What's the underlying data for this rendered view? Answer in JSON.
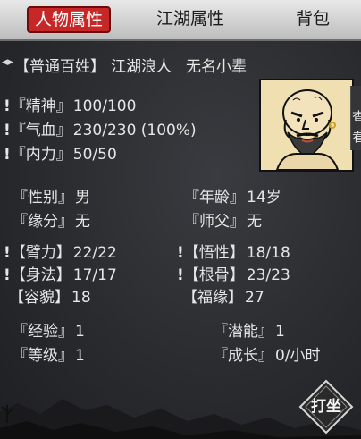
{
  "tabs": [
    {
      "label": "人物属性",
      "active": true
    },
    {
      "label": "江湖属性",
      "active": false
    },
    {
      "label": "背包",
      "active": false
    }
  ],
  "header": {
    "rank": "【普通百姓】",
    "title": "江湖浪人",
    "epithet": "无名小辈"
  },
  "vitals": [
    {
      "label": "『精神』",
      "value": "100/100"
    },
    {
      "label": "『气血』",
      "value": "230/230 (100%)"
    },
    {
      "label": "『内力』",
      "value": "50/50"
    }
  ],
  "side_button": {
    "line1": "查",
    "line2": "看"
  },
  "info": [
    {
      "label": "『性别』",
      "value": "男"
    },
    {
      "label": "『年龄』",
      "value": "14岁"
    },
    {
      "label": "『缘分』",
      "value": "无"
    },
    {
      "label": "『师父』",
      "value": "无"
    }
  ],
  "attributes": [
    {
      "label": "【臂力】",
      "value": "22/22"
    },
    {
      "label": "【悟性】",
      "value": "18/18"
    },
    {
      "label": "【身法】",
      "value": "17/17"
    },
    {
      "label": "【根骨】",
      "value": "23/23"
    },
    {
      "label": "【容貌】",
      "value": "18"
    },
    {
      "label": "【福缘】",
      "value": "27"
    }
  ],
  "growth": [
    {
      "label": "『经验』",
      "value": "1"
    },
    {
      "label": "『潜能』",
      "value": "1"
    },
    {
      "label": "『等级』",
      "value": "1"
    },
    {
      "label": "『成长』",
      "value": "0/小时"
    }
  ],
  "meditate_label": "打坐",
  "alert_glyph": "!",
  "colors": {
    "tab_active": "#c62828",
    "portrait_bg": "#f0dfb0",
    "background": "#2b2c30"
  }
}
